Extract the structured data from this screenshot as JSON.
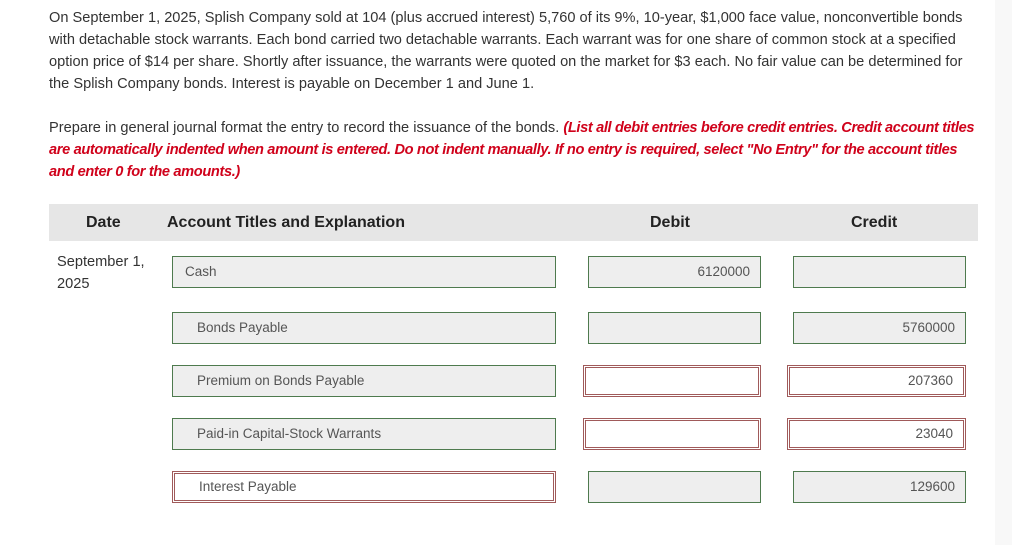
{
  "problem_text": "On September 1, 2025, Splish Company sold at 104 (plus accrued interest) 5,760 of its 9%, 10-year, $1,000 face value, nonconvertible bonds with detachable stock warrants. Each bond carried two detachable warrants. Each warrant was for one share of common stock at a specified option price of $14 per share. Shortly after issuance, the warrants were quoted on the market for $3 each. No fair value can be determined for the Splish Company bonds. Interest is payable on December 1 and June 1.",
  "instructions": {
    "prompt": "Prepare in general journal format the entry to record the issuance of the bonds. ",
    "note": "(List all debit entries before credit entries. Credit account titles are automatically indented when amount is entered. Do not indent manually. If no entry is required, select \"No Entry\" for the account titles and enter 0 for the amounts.)"
  },
  "table": {
    "headers": {
      "date": "Date",
      "account": "Account Titles and Explanation",
      "debit": "Debit",
      "credit": "Credit"
    },
    "date": "September 1, 2025",
    "rows": [
      {
        "account": "Cash",
        "debit": "6120000",
        "credit": "",
        "account_status": "correct",
        "debit_status": "correct",
        "credit_status": "correct"
      },
      {
        "account": "Bonds Payable",
        "debit": "",
        "credit": "5760000",
        "account_status": "correct",
        "debit_status": "correct",
        "credit_status": "correct"
      },
      {
        "account": "Premium on Bonds Payable",
        "debit": "",
        "credit": "207360",
        "account_status": "correct",
        "debit_status": "incorrect",
        "credit_status": "incorrect"
      },
      {
        "account": "Paid-in Capital-Stock Warrants",
        "debit": "",
        "credit": "23040",
        "account_status": "correct",
        "debit_status": "incorrect",
        "credit_status": "incorrect"
      },
      {
        "account": "Interest Payable",
        "debit": "",
        "credit": "129600",
        "account_status": "incorrect",
        "debit_status": "correct",
        "credit_status": "correct"
      }
    ]
  },
  "colors": {
    "correct_border": "#4e7a4e",
    "incorrect_border": "#a05a5a",
    "instruction_red": "#d0021b",
    "header_bg": "#e6e6e6"
  }
}
